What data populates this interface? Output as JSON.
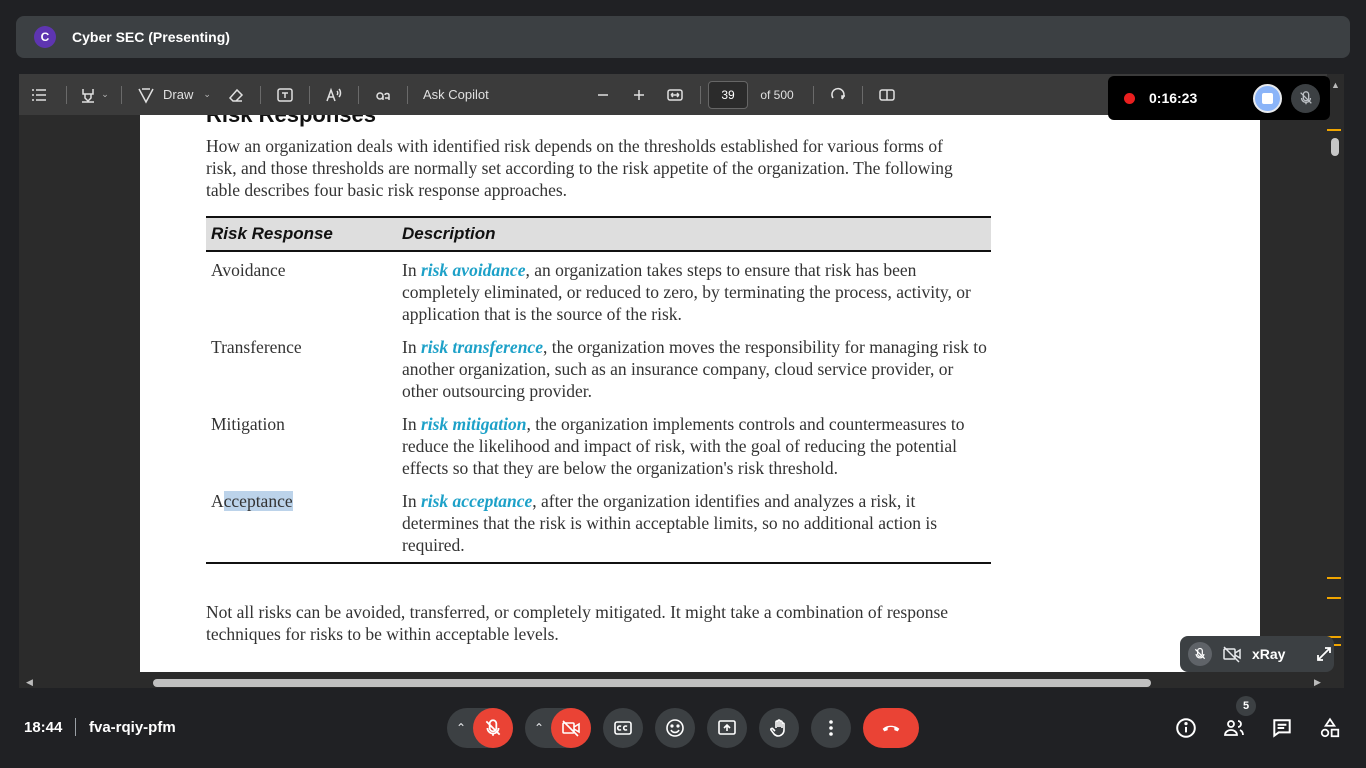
{
  "presenter": {
    "avatar_letter": "C",
    "title": "Cyber SEC (Presenting)"
  },
  "pdf_toolbar": {
    "draw_label": "Draw",
    "ask_copilot_label": "Ask Copilot",
    "page_number": "39",
    "page_total": "of 500"
  },
  "document": {
    "heading_cut": "Risk Responses",
    "intro": "How an organization deals with identified risk depends on the thresholds established for various forms of risk, and those thresholds are normally set according to the risk appetite of the organization. The following table describes four basic risk response approaches.",
    "table": {
      "headers": [
        "Risk Response",
        "Description"
      ],
      "rows": [
        {
          "response": "Avoidance",
          "pre": "In ",
          "term": "risk avoidance",
          "post": ", an organization takes steps to ensure that risk has been completely eliminated, or reduced to zero, by terminating the process, activity, or application that is the source of the risk."
        },
        {
          "response": "Transference",
          "pre": "In ",
          "term": "risk transference",
          "post": ", the organization moves the responsibility for managing risk to another organization, such as an insurance company, cloud service provider, or other outsourcing provider."
        },
        {
          "response": "Mitigation",
          "pre": "In ",
          "term": "risk mitigation",
          "post": ", the organization implements controls and countermeasures to reduce the likelihood and impact of risk, with the goal of reducing the potential effects so that they are below the organization's risk threshold."
        },
        {
          "response_a": "A",
          "response_b": "cceptance",
          "pre": "In ",
          "term": "risk acceptance",
          "post": ", after the organization identifies and analyzes a risk, it determines that the risk is within acceptable limits, so no additional action is required."
        }
      ]
    },
    "outro": "Not all risks can be avoided, transferred, or completely mitigated. It might take a combination of response techniques for risks to be within acceptable levels."
  },
  "recording": {
    "time": "0:16:23"
  },
  "self_tile": {
    "name": "xRay"
  },
  "bottom_bar": {
    "time": "18:44",
    "meeting_code": "fva-rqiy-pfm",
    "participants_count": "5"
  },
  "colors": {
    "term": "#1da1c8",
    "highlight": "#bcd3ea",
    "danger": "#ea4335",
    "recording": "#ea1f1f",
    "stop": "#8ab4f8"
  }
}
